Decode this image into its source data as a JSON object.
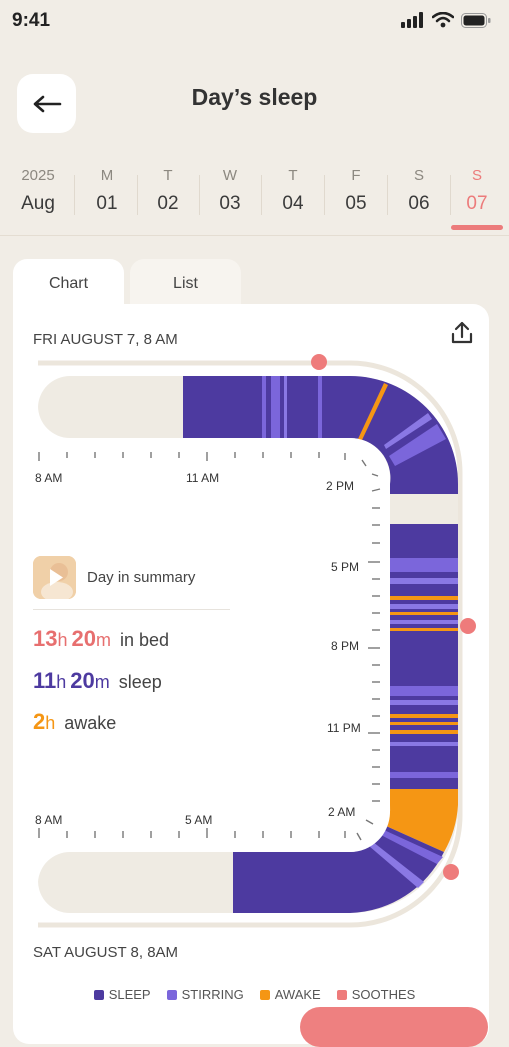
{
  "status_bar": {
    "time": "9:41"
  },
  "header": {
    "title": "Day’s sleep"
  },
  "date_strip": {
    "year": "2025",
    "month": "Aug",
    "days": [
      {
        "dow": "M",
        "day": "01"
      },
      {
        "dow": "T",
        "day": "02"
      },
      {
        "dow": "W",
        "day": "03"
      },
      {
        "dow": "T",
        "day": "04"
      },
      {
        "dow": "F",
        "day": "05"
      },
      {
        "dow": "S",
        "day": "06"
      },
      {
        "dow": "S",
        "day": "07",
        "selected": true
      }
    ]
  },
  "tabs": [
    {
      "label": "Chart",
      "active": true
    },
    {
      "label": "List",
      "active": false
    }
  ],
  "card": {
    "start_label": "FRI AUGUST 7, 8 AM",
    "end_label": "SAT AUGUST 8, 8AM"
  },
  "chart_labels": {
    "top_row": [
      "8 AM",
      "11 AM",
      "2 PM"
    ],
    "right_column": [
      "5 PM",
      "8 PM",
      "11 PM"
    ],
    "bottom_row": [
      "8 AM",
      "5 AM",
      "2 AM"
    ]
  },
  "summary": {
    "title": "Day in summary",
    "in_bed": {
      "h": "13",
      "h_unit": "h",
      "m": "20",
      "m_unit": "m",
      "label": "in bed"
    },
    "sleep": {
      "h": "11",
      "h_unit": "h",
      "m": "20",
      "m_unit": "m",
      "label": "sleep"
    },
    "awake": {
      "h": "2",
      "h_unit": "h",
      "label": "awake"
    }
  },
  "legend": [
    {
      "label": "SLEEP",
      "color": "#4d3aa0"
    },
    {
      "label": "STIRRING",
      "color": "#7b66db"
    },
    {
      "label": "AWAKE",
      "color": "#f59614"
    },
    {
      "label": "SOOTHES",
      "color": "#ee7b7b"
    }
  ],
  "colors": {
    "sleep": "#4d3aa0",
    "stirring": "#7b66db",
    "awake": "#f59614",
    "soothes": "#ee7b7b",
    "track": "#efebe3",
    "selected": "#ec7b7b"
  },
  "icons": {
    "back": "arrow-left-icon",
    "share": "share-upload-icon",
    "signal": "cellular-signal-icon",
    "wifi": "wifi-icon",
    "battery": "battery-icon",
    "thumbnail_play": "play-icon"
  }
}
